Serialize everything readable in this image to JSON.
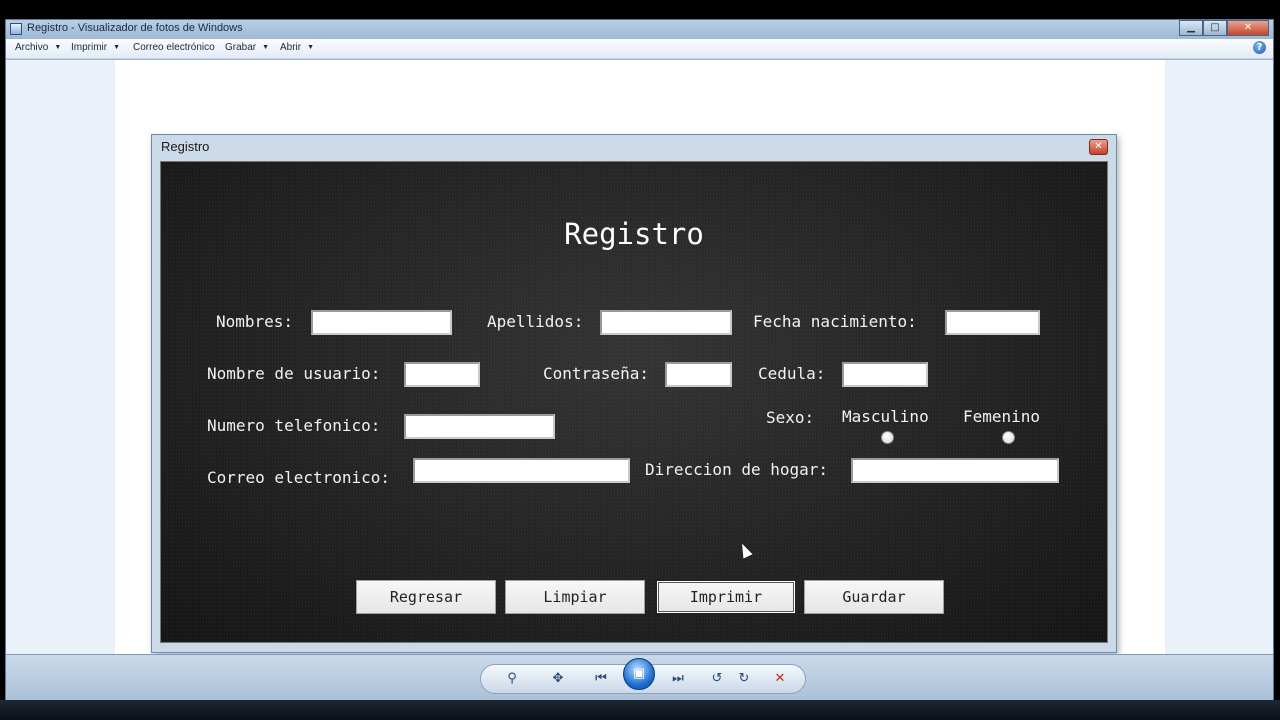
{
  "viewer": {
    "title": "Registro - Visualizador de fotos de Windows",
    "controls": {
      "minimize": "▁",
      "maximize": "□",
      "close": "✕"
    },
    "menu": [
      {
        "label": "Archivo",
        "has_dropdown": true
      },
      {
        "label": "Imprimir",
        "has_dropdown": true
      },
      {
        "label": "Correo electrónico",
        "has_dropdown": false
      },
      {
        "label": "Grabar",
        "has_dropdown": true
      },
      {
        "label": "Abrir",
        "has_dropdown": true
      }
    ],
    "help_label": "?"
  },
  "form_window": {
    "title": "Registro",
    "close_label": "✕",
    "heading": "Registro",
    "labels": {
      "nombres": "Nombres:",
      "apellidos": "Apellidos:",
      "fecha_nacimiento": "Fecha nacimiento:",
      "nombre_usuario": "Nombre de usuario:",
      "contrasena": "Contraseña:",
      "cedula": "Cedula:",
      "numero_telefonico": "Numero telefonico:",
      "sexo": "Sexo:",
      "masculino": "Masculino",
      "femenino": "Femenino",
      "correo_electronico": "Correo electronico:",
      "direccion_hogar": "Direccion de hogar:"
    },
    "fields": {
      "nombres": "",
      "apellidos": "",
      "fecha_nacimiento": "",
      "nombre_usuario": "",
      "contrasena": "",
      "cedula": "",
      "numero_telefonico": "",
      "correo_electronico": "",
      "direccion_hogar": ""
    },
    "buttons": {
      "regresar": "Regresar",
      "limpiar": "Limpiar",
      "imprimir": "Imprimir",
      "guardar": "Guardar"
    },
    "focused_button": "imprimir"
  },
  "control_bar": {
    "zoom": "⚲",
    "fit": "✥",
    "previous": "⏮",
    "slideshow": "▣",
    "next": "⏭",
    "rotate_left": "↺",
    "rotate_right": "↻",
    "delete": "✕"
  },
  "icons": [
    "app-icon",
    "help-icon",
    "close-icon",
    "zoom-icon",
    "fit-icon",
    "previous-icon",
    "slideshow-icon",
    "next-icon",
    "rotate-left-icon",
    "rotate-right-icon",
    "delete-icon",
    "mouse-cursor-icon"
  ]
}
